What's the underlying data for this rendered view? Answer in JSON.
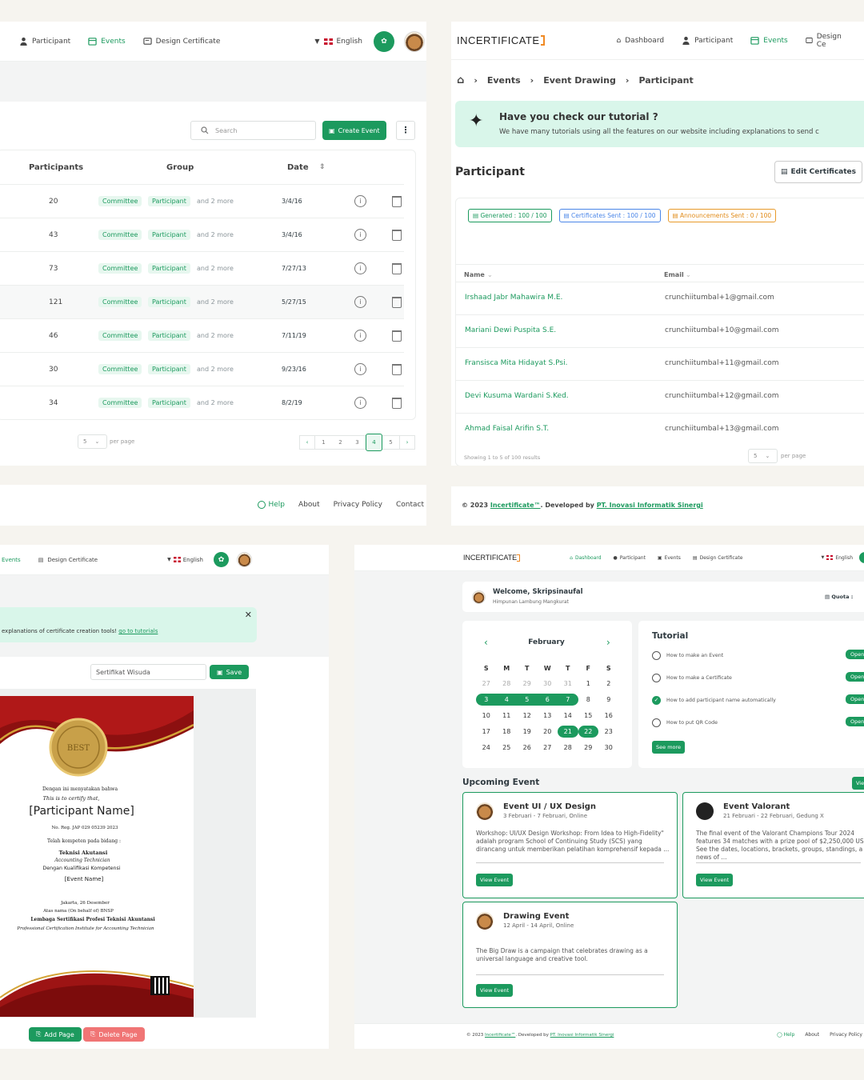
{
  "p1": {
    "nav": {
      "participant": "Participant",
      "events": "Events",
      "design": "Design Certificate",
      "language": "English"
    },
    "search_placeholder": "Search",
    "create_event": "Create Event",
    "headers": {
      "participants": "Participants",
      "group": "Group",
      "date": "Date"
    },
    "rows": [
      {
        "participants": "20",
        "g1": "Committee",
        "g2": "Participant",
        "more": "and 2 more",
        "date": "3/4/16"
      },
      {
        "participants": "43",
        "g1": "Committee",
        "g2": "Participant",
        "more": "and 2 more",
        "date": "3/4/16"
      },
      {
        "participants": "73",
        "g1": "Committee",
        "g2": "Participant",
        "more": "and 2 more",
        "date": "7/27/13"
      },
      {
        "participants": "121",
        "g1": "Committee",
        "g2": "Participant",
        "more": "and 2 more",
        "date": "5/27/15"
      },
      {
        "participants": "46",
        "g1": "Committee",
        "g2": "Participant",
        "more": "and 2 more",
        "date": "7/11/19"
      },
      {
        "participants": "30",
        "g1": "Committee",
        "g2": "Participant",
        "more": "and 2 more",
        "date": "9/23/16"
      },
      {
        "participants": "34",
        "g1": "Committee",
        "g2": "Participant",
        "more": "and 2 more",
        "date": "8/2/19"
      }
    ],
    "per_page_value": "5",
    "per_page_label": "per page",
    "pages": [
      "1",
      "2",
      "3",
      "4",
      "5"
    ],
    "current_page": "4",
    "footer": {
      "help": "Help",
      "about": "About",
      "privacy": "Privacy Policy",
      "contact": "Contact"
    }
  },
  "p2": {
    "logo": "INCERTIFICATE",
    "nav": {
      "dashboard": "Dashboard",
      "participant": "Participant",
      "events": "Events",
      "design": "Design Ce"
    },
    "breadcrumb": {
      "b1": "Events",
      "b2": "Event Drawing",
      "b3": "Participant"
    },
    "tutorial_title": "Have you check our tutorial ?",
    "tutorial_text": "We have many tutorials using all the features on our website including explanations to send c",
    "title": "Participant",
    "edit_cert": "Edit Certificates",
    "badges": {
      "generated": "Generated : 100 / 100",
      "sent": "Certificates Sent : 100 / 100",
      "announce": "Announcements Sent : 0 / 100"
    },
    "headers": {
      "name": "Name",
      "email": "Email"
    },
    "rows": [
      {
        "name": "Irshaad Jabr Mahawira M.E.",
        "email": "crunchiitumbal+1@gmail.com"
      },
      {
        "name": "Mariani Dewi Puspita S.E.",
        "email": "crunchiitumbal+10@gmail.com"
      },
      {
        "name": "Fransisca Mita Hidayat S.Psi.",
        "email": "crunchiitumbal+11@gmail.com"
      },
      {
        "name": "Devi Kusuma Wardani S.Ked.",
        "email": "crunchiitumbal+12@gmail.com"
      },
      {
        "name": "Ahmad Faisal Arifin S.T.",
        "email": "crunchiitumbal+13@gmail.com"
      }
    ],
    "showing": "Showing 1 to 5 of 100 results",
    "per_page_value": "5",
    "per_page_label": "per page",
    "footer": {
      "pre": "© 2023 ",
      "brand": "Incertificate™",
      "mid": ". Developed by ",
      "dev": "PT. Inovasi Informatik Sinergi"
    }
  },
  "p3": {
    "nav": {
      "events": "Events",
      "design": "Design Certificate",
      "language": "English"
    },
    "banner_text": "explanations of certificate creation tools! ",
    "banner_link": "go to tutorials",
    "name_value": "Sertifikat Wisuda",
    "save": "Save",
    "cert": {
      "seal": "BEST",
      "l1": "Dengan ini menyatakan bahwa",
      "l2": "This is to certify that,",
      "name": "[Participant Name]",
      "reg": "No. Reg. JAP 029 05239 2023",
      "l3": "Telah kompeten pada bidang :",
      "l4": "Teknisi Akutansi",
      "l5": "Accounting Technician",
      "l6": "Dengan Kualifikasi Kompetensi",
      "l7": "[Event Name]",
      "l8": "Jakarta, 26 Desember",
      "l9": "Atas nama (On behalf of) BNSP",
      "l10": "Lembaga Sertifikasi Profesi Teknisi Akuntansi",
      "l11": "Professional Certification Institute for Accounting Technician"
    },
    "add_page": "Add Page",
    "delete_page": "Delete Page"
  },
  "p4": {
    "logo": "INCERTIFICATE",
    "nav": {
      "dashboard": "Dashboard",
      "participant": "Participant",
      "events": "Events",
      "design": "Design Certificate",
      "language": "English"
    },
    "welcome": "Welcome, Skripsinaufal",
    "org": "Himpunan Lambung Mangkurat",
    "quota": "Quota",
    "month": "February",
    "weekdays": [
      "S",
      "M",
      "T",
      "W",
      "T",
      "F",
      "S"
    ],
    "weeks": [
      [
        "27",
        "28",
        "29",
        "30",
        "31",
        "1",
        "2"
      ],
      [
        "3",
        "4",
        "5",
        "6",
        "7",
        "8",
        "9"
      ],
      [
        "10",
        "11",
        "12",
        "13",
        "14",
        "15",
        "16"
      ],
      [
        "17",
        "18",
        "19",
        "20",
        "21",
        "22",
        "23"
      ],
      [
        "24",
        "25",
        "26",
        "27",
        "28",
        "29",
        "30"
      ]
    ],
    "tutorial_title": "Tutorial",
    "tutorials": [
      {
        "label": "How to make an Event",
        "done": false
      },
      {
        "label": "How to make a Certificate",
        "done": false
      },
      {
        "label": "How to add participant name automatically",
        "done": true
      },
      {
        "label": "How to put QR Code",
        "done": false
      }
    ],
    "open": "Open",
    "see_more": "See more",
    "upcoming": "Upcoming Event",
    "view_all": "Vie",
    "events": [
      {
        "title": "Event UI / UX Design",
        "date": "3 Februari - 7 Februari, Online",
        "desc": "Workshop: UI/UX Design Workshop: From Idea to High-Fidelity\" adalah program School of Continuing Study (SCS) yang dirancang untuk memberikan pelatihan komprehensif kepada ..."
      },
      {
        "title": "Event Valorant",
        "date": "21 Februari - 22 Februari, Gedung X",
        "desc": "The final event of the Valorant Champions Tour 2024 features 34 matches with a prize pool of $2,250,000 US See the dates, locations, brackets, groups, standings, a news of ..."
      },
      {
        "title": "Drawing Event",
        "date": "12 April - 14 April, Online",
        "desc": "The Big Draw is a campaign that celebrates drawing as a universal language and creative tool."
      }
    ],
    "view_event": "View Event",
    "footer": {
      "pre": "© 2023 ",
      "brand": "Incertificate™",
      "mid": ". Developed by ",
      "dev": "PT. Inovasi Informatik Sinergi",
      "help": "Help",
      "about": "About",
      "privacy": "Privacy Policy"
    }
  }
}
